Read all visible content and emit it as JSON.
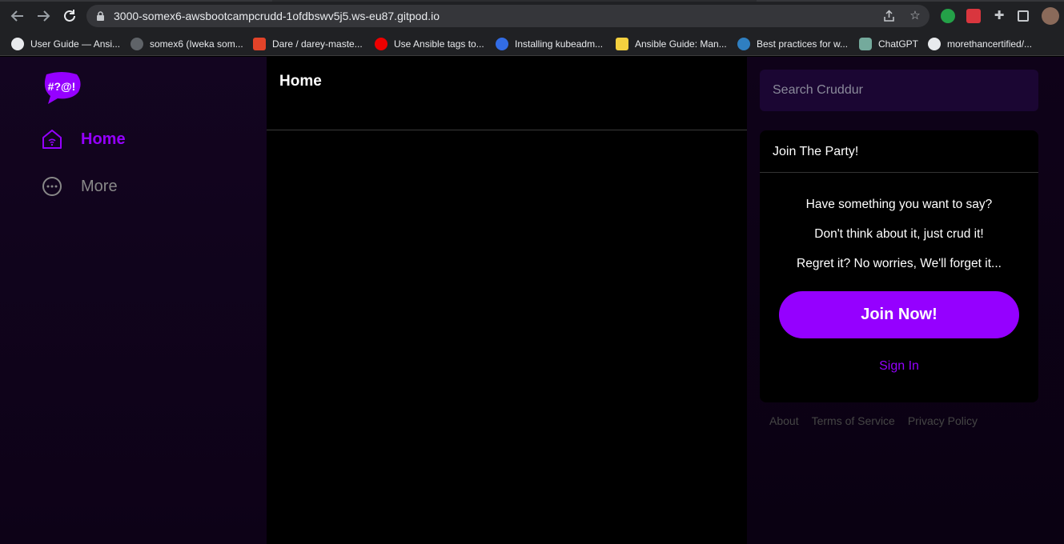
{
  "browser": {
    "url": "3000-somex6-awsbootcampcrudd-1ofdbswv5j5.ws-eu87.gitpod.io",
    "bookmarks": [
      {
        "label": "User Guide — Ansi...",
        "icon": "globe-icon"
      },
      {
        "label": "somex6 (Iweka som...",
        "icon": "github-icon"
      },
      {
        "label": "Dare / darey-maste...",
        "icon": "gitlab-icon"
      },
      {
        "label": "Use Ansible tags to...",
        "icon": "redhat-icon"
      },
      {
        "label": "Installing kubeadm...",
        "icon": "kubernetes-icon"
      },
      {
        "label": "Ansible Guide: Man...",
        "icon": "lightbulb-icon"
      },
      {
        "label": "Best practices for w...",
        "icon": "circle-site-icon"
      },
      {
        "label": "ChatGPT",
        "icon": "chatgpt-icon"
      },
      {
        "label": "morethancertified/...",
        "icon": "github-icon"
      }
    ]
  },
  "sidebar": {
    "logo_text": "#?@!",
    "items": [
      {
        "label": "Home",
        "icon": "home-icon",
        "active": true
      },
      {
        "label": "More",
        "icon": "more-icon",
        "active": false
      }
    ]
  },
  "feed": {
    "title": "Home"
  },
  "search": {
    "placeholder": "Search Cruddur"
  },
  "join": {
    "title": "Join The Party!",
    "lines": [
      "Have something you want to say?",
      "Don't think about it, just crud it!",
      "Regret it? No worries, We'll forget it..."
    ],
    "button": "Join Now!",
    "signin": "Sign In"
  },
  "footer": {
    "links": [
      "About",
      "Terms of Service",
      "Privacy Policy"
    ]
  },
  "colors": {
    "accent": "#9500ff",
    "sidebar_bg": "#130520",
    "search_bg": "#1b0633"
  }
}
